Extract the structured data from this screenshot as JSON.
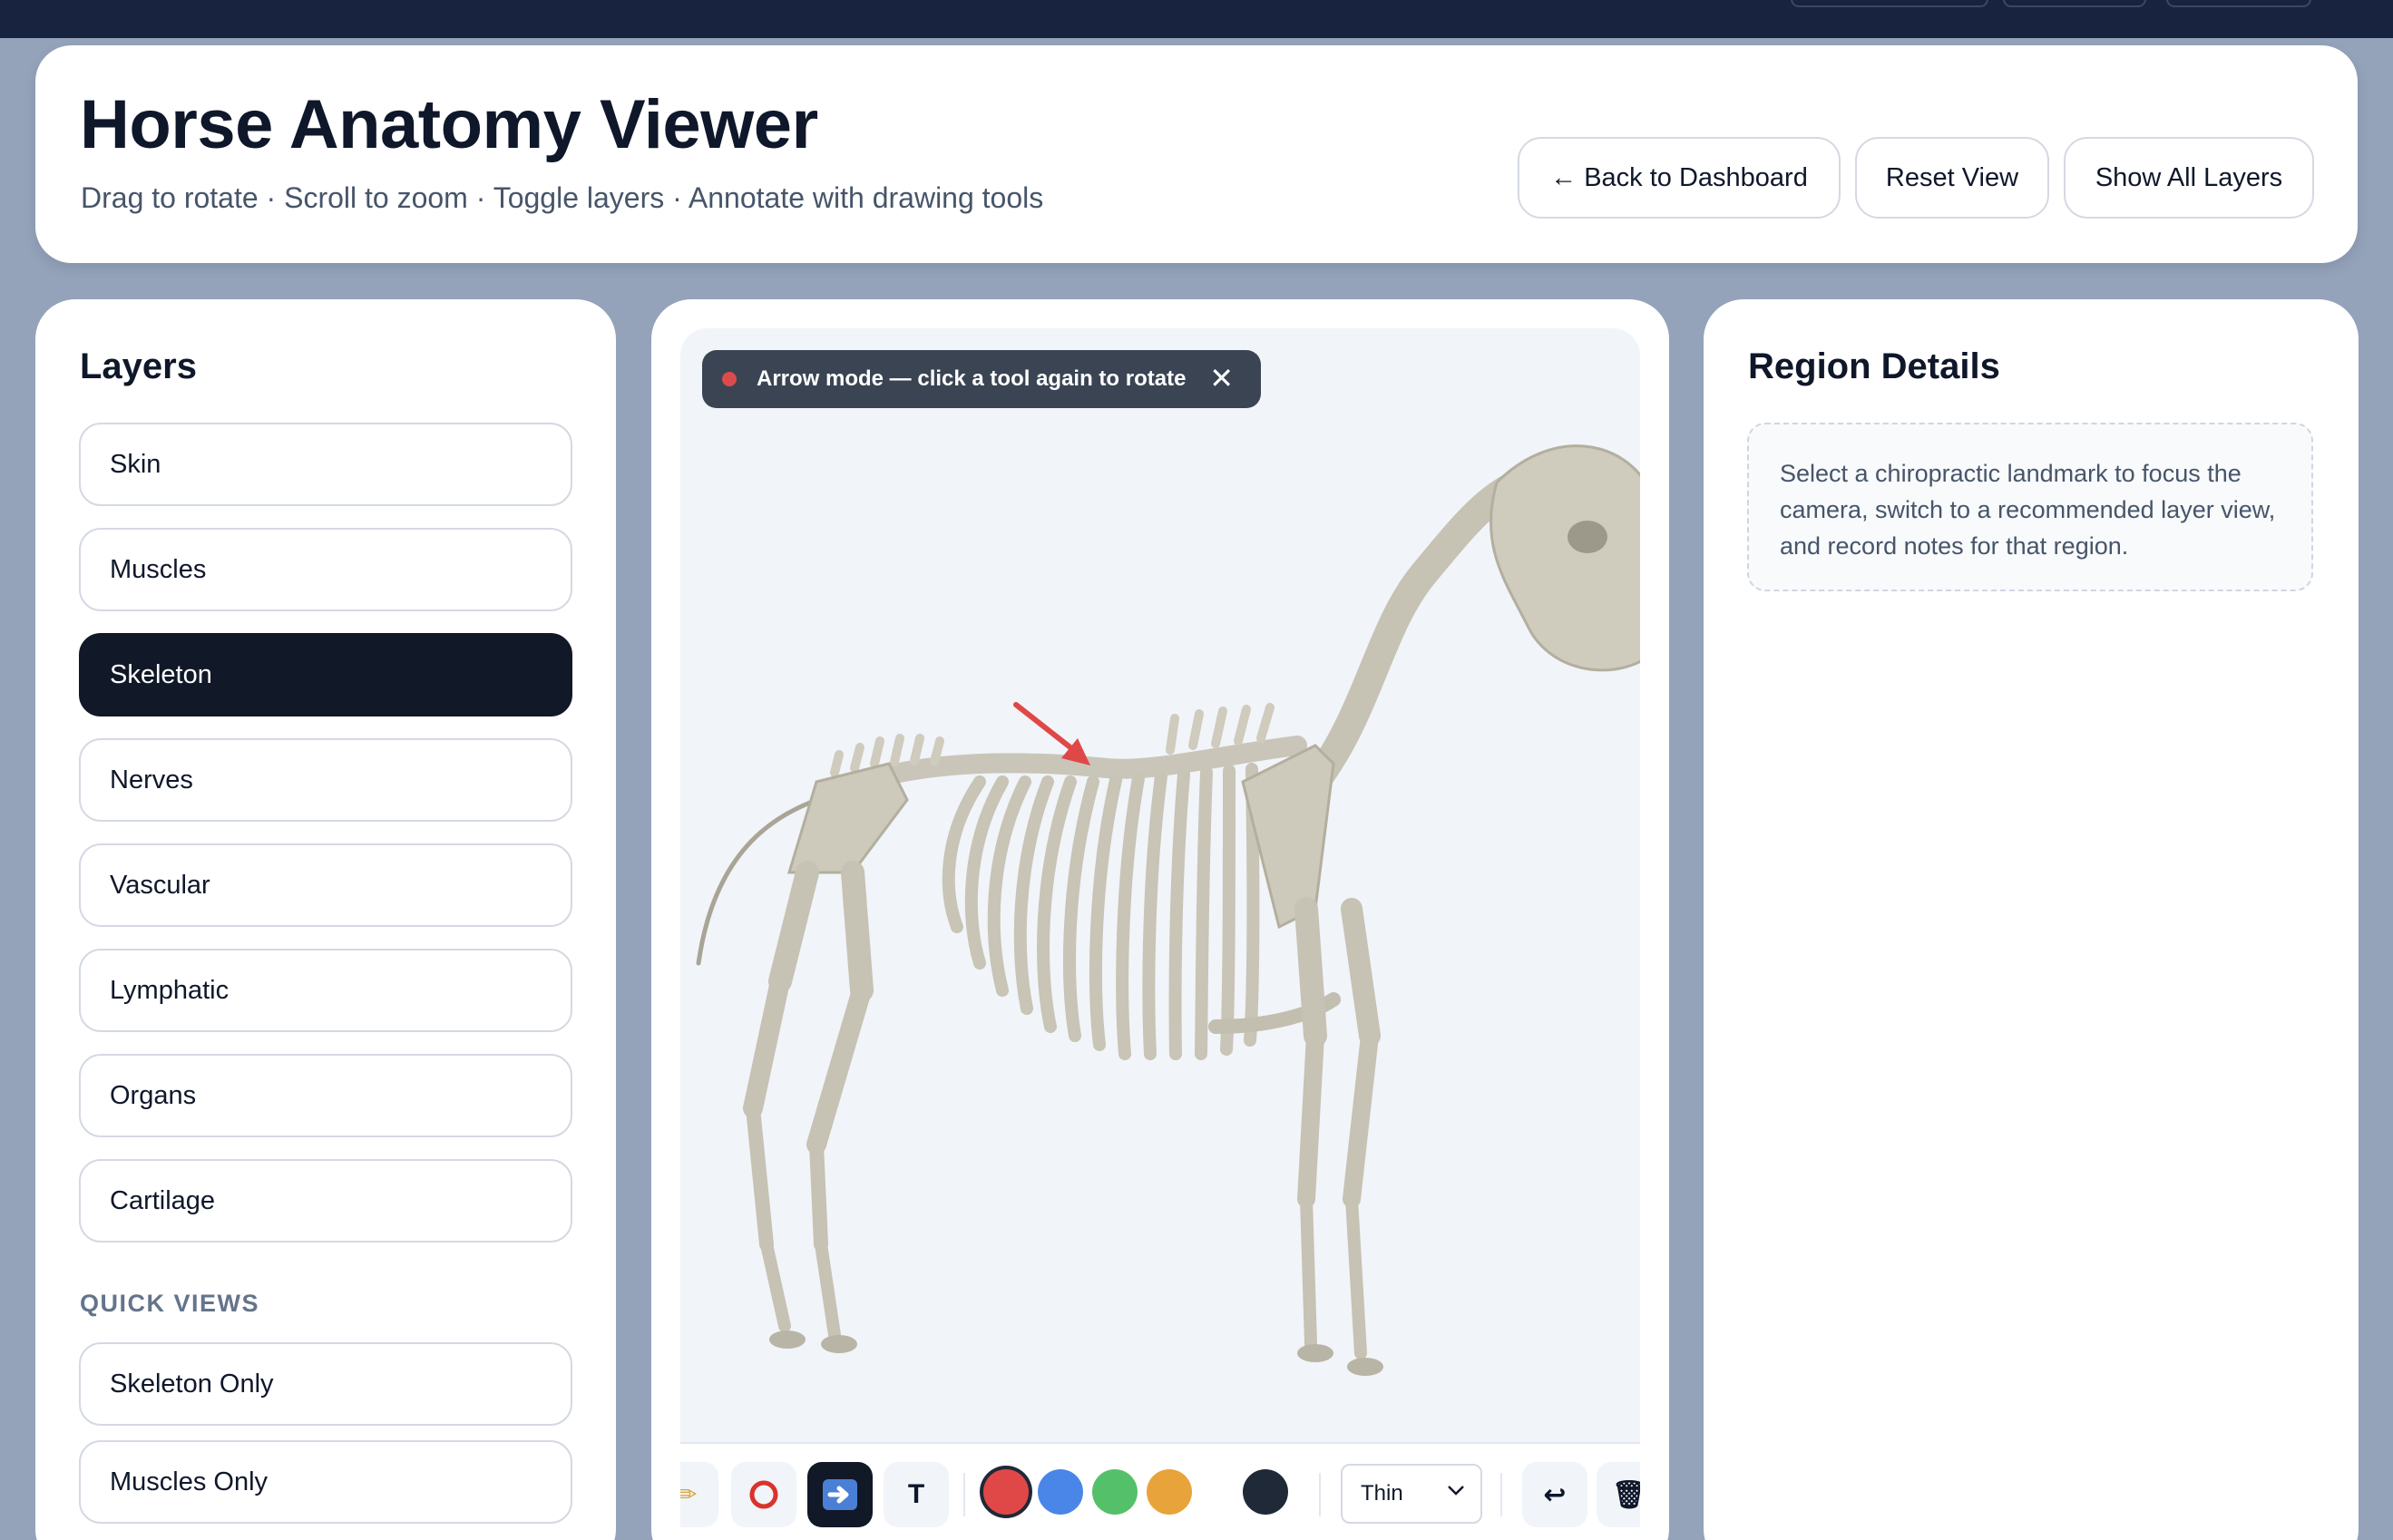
{
  "header": {
    "title": "Horse Anatomy Viewer",
    "subtitle": "Drag to rotate · Scroll to zoom · Toggle layers · Annotate with drawing tools",
    "buttons": {
      "back": "← Back to Dashboard",
      "reset": "Reset View",
      "show_all": "Show All Layers"
    }
  },
  "layers": {
    "title": "Layers",
    "items": [
      {
        "label": "Skin",
        "active": false
      },
      {
        "label": "Muscles",
        "active": false
      },
      {
        "label": "Skeleton",
        "active": true
      },
      {
        "label": "Nerves",
        "active": false
      },
      {
        "label": "Vascular",
        "active": false
      },
      {
        "label": "Lymphatic",
        "active": false
      },
      {
        "label": "Organs",
        "active": false
      },
      {
        "label": "Cartilage",
        "active": false
      }
    ],
    "quick_views_label": "QUICK VIEWS",
    "quick_views": [
      {
        "label": "Skeleton Only"
      },
      {
        "label": "Muscles Only"
      }
    ]
  },
  "viewer": {
    "mode_chip": "Arrow mode — click a tool again to rotate",
    "mode_close": "✕",
    "tools": [
      {
        "name": "pencil-icon",
        "glyph": "✏"
      },
      {
        "name": "circle-icon",
        "glyph": "○"
      },
      {
        "name": "arrow-icon",
        "glyph": "➡",
        "active": true
      },
      {
        "name": "text-icon",
        "glyph": "T"
      }
    ],
    "colors": [
      "#e04848",
      "#4a86e8",
      "#55c06a",
      "#e8a33a",
      "#1f2937"
    ],
    "selected_color": "#e04848",
    "thickness": "Thin",
    "undo_glyph": "↩",
    "trash_glyph": "🗑"
  },
  "details": {
    "title": "Region Details",
    "empty_text": "Select a chiropractic landmark to focus the camera, switch to a recommended layer view, and record notes for that region."
  }
}
